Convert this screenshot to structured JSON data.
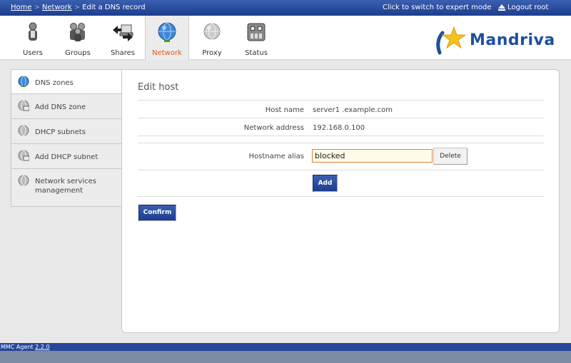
{
  "breadcrumb": {
    "home": "Home",
    "network": "Network",
    "current": "Edit a DNS record",
    "sep": ">"
  },
  "topbar": {
    "expert_mode": "Click to switch to expert mode",
    "logout": "Logout root"
  },
  "nav": {
    "items": [
      {
        "label": "Users",
        "icon": "users-icon"
      },
      {
        "label": "Groups",
        "icon": "groups-icon"
      },
      {
        "label": "Shares",
        "icon": "shares-icon"
      },
      {
        "label": "Network",
        "icon": "network-globe-icon",
        "active": true
      },
      {
        "label": "Proxy",
        "icon": "proxy-icon"
      },
      {
        "label": "Status",
        "icon": "status-icon"
      }
    ]
  },
  "logo": {
    "text": "Mandriva"
  },
  "sidebar": {
    "items": [
      {
        "label": "DNS zones",
        "icon": "globe-icon"
      },
      {
        "label": "Add DNS zone",
        "icon": "globe-add-icon"
      },
      {
        "label": "DHCP subnets",
        "icon": "globe-icon"
      },
      {
        "label": "Add DHCP subnet",
        "icon": "globe-add-icon"
      },
      {
        "label": "Network services management",
        "icon": "globe-icon"
      }
    ]
  },
  "form": {
    "title": "Edit host",
    "host_name_label": "Host name",
    "host_name_value": "server1 .example.com",
    "network_address_label": "Network address",
    "network_address_value": "192.168.0.100",
    "alias_label": "Hostname alias",
    "alias_value": "blocked",
    "delete_label": "Delete",
    "add_label": "Add",
    "confirm_label": "Confirm"
  },
  "footer": {
    "prefix": "MMC Agent",
    "version": "2.2.0"
  },
  "colors": {
    "accent_blue": "#1d3d8f",
    "active_tab_text": "#e05a1a",
    "input_border": "#e0823a"
  }
}
